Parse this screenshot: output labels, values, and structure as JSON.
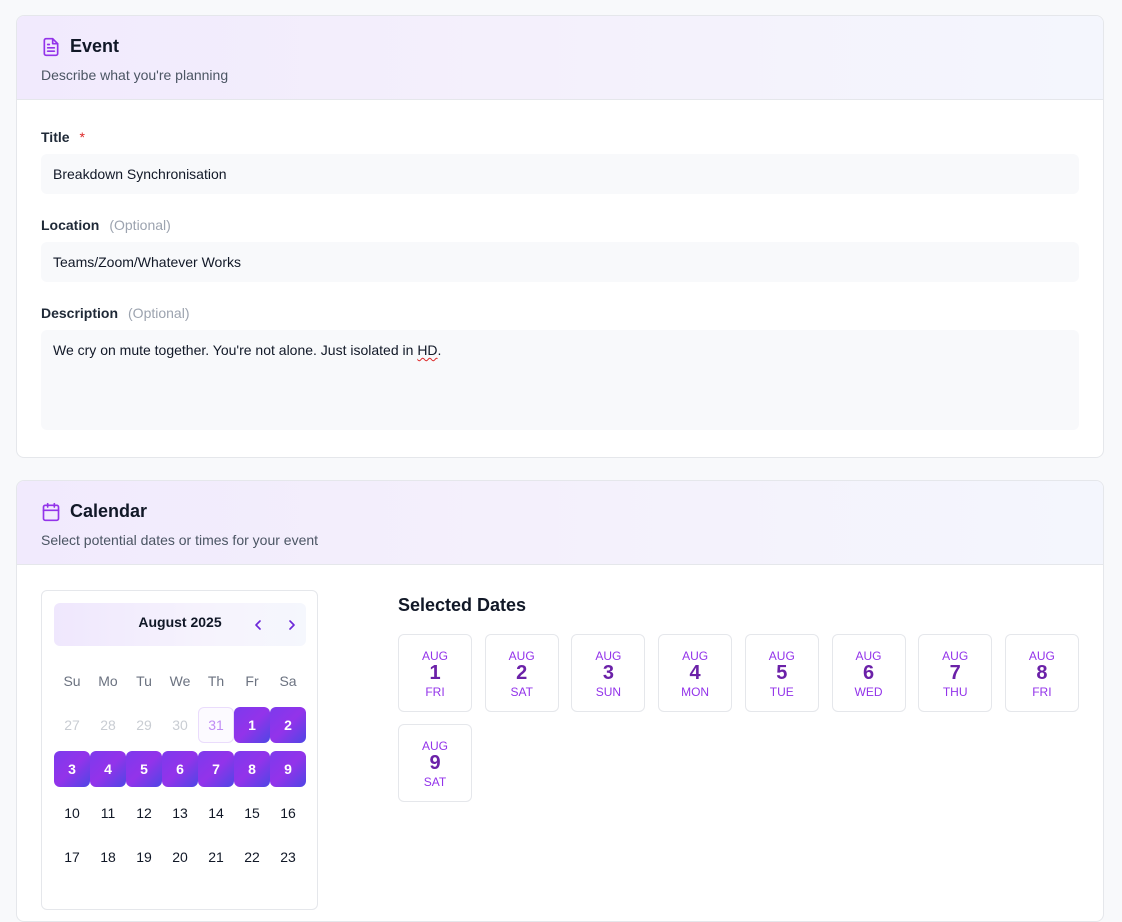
{
  "event": {
    "title": "Event",
    "subtitle": "Describe what you're planning",
    "fields": {
      "title": {
        "label": "Title",
        "required_mark": "*",
        "value": "Breakdown Synchronisation"
      },
      "location": {
        "label": "Location",
        "optional": "(Optional)",
        "value": "Teams/Zoom/Whatever Works"
      },
      "description": {
        "label": "Description",
        "optional": "(Optional)",
        "value_prefix": "We cry on mute together. You're not alone. Just isolated in ",
        "value_spell": "HD",
        "value_suffix": "."
      }
    }
  },
  "calendar": {
    "title": "Calendar",
    "subtitle": "Select potential dates or times for your event",
    "month_label": "August 2025",
    "weekdays": [
      "Su",
      "Mo",
      "Tu",
      "We",
      "Th",
      "Fr",
      "Sa"
    ],
    "days": [
      {
        "label": "27",
        "state": "outside"
      },
      {
        "label": "28",
        "state": "outside"
      },
      {
        "label": "29",
        "state": "outside"
      },
      {
        "label": "30",
        "state": "outside"
      },
      {
        "label": "31",
        "state": "today"
      },
      {
        "label": "1",
        "state": "selected"
      },
      {
        "label": "2",
        "state": "selected"
      },
      {
        "label": "3",
        "state": "selected"
      },
      {
        "label": "4",
        "state": "selected"
      },
      {
        "label": "5",
        "state": "selected"
      },
      {
        "label": "6",
        "state": "selected"
      },
      {
        "label": "7",
        "state": "selected"
      },
      {
        "label": "8",
        "state": "selected"
      },
      {
        "label": "9",
        "state": "selected"
      },
      {
        "label": "10",
        "state": "normal"
      },
      {
        "label": "11",
        "state": "normal"
      },
      {
        "label": "12",
        "state": "normal"
      },
      {
        "label": "13",
        "state": "normal"
      },
      {
        "label": "14",
        "state": "normal"
      },
      {
        "label": "15",
        "state": "normal"
      },
      {
        "label": "16",
        "state": "normal"
      },
      {
        "label": "17",
        "state": "normal"
      },
      {
        "label": "18",
        "state": "normal"
      },
      {
        "label": "19",
        "state": "normal"
      },
      {
        "label": "20",
        "state": "normal"
      },
      {
        "label": "21",
        "state": "normal"
      },
      {
        "label": "22",
        "state": "normal"
      },
      {
        "label": "23",
        "state": "normal"
      }
    ],
    "selected_title": "Selected Dates",
    "selected_dates": [
      {
        "month": "AUG",
        "day": "1",
        "weekday": "FRI"
      },
      {
        "month": "AUG",
        "day": "2",
        "weekday": "SAT"
      },
      {
        "month": "AUG",
        "day": "3",
        "weekday": "SUN"
      },
      {
        "month": "AUG",
        "day": "4",
        "weekday": "MON"
      },
      {
        "month": "AUG",
        "day": "5",
        "weekday": "TUE"
      },
      {
        "month": "AUG",
        "day": "6",
        "weekday": "WED"
      },
      {
        "month": "AUG",
        "day": "7",
        "weekday": "THU"
      },
      {
        "month": "AUG",
        "day": "8",
        "weekday": "FRI"
      },
      {
        "month": "AUG",
        "day": "9",
        "weekday": "SAT"
      }
    ]
  },
  "icons": {
    "event": "document-icon",
    "calendar": "calendar-icon",
    "prev": "chevron-left-icon",
    "next": "chevron-right-icon"
  },
  "colors": {
    "accent": "#9333ea",
    "accent_dark": "#6b21a8",
    "selected_gradient_start": "#7c3aed",
    "selected_gradient_end": "#4f46e5",
    "required": "#dc2626"
  }
}
